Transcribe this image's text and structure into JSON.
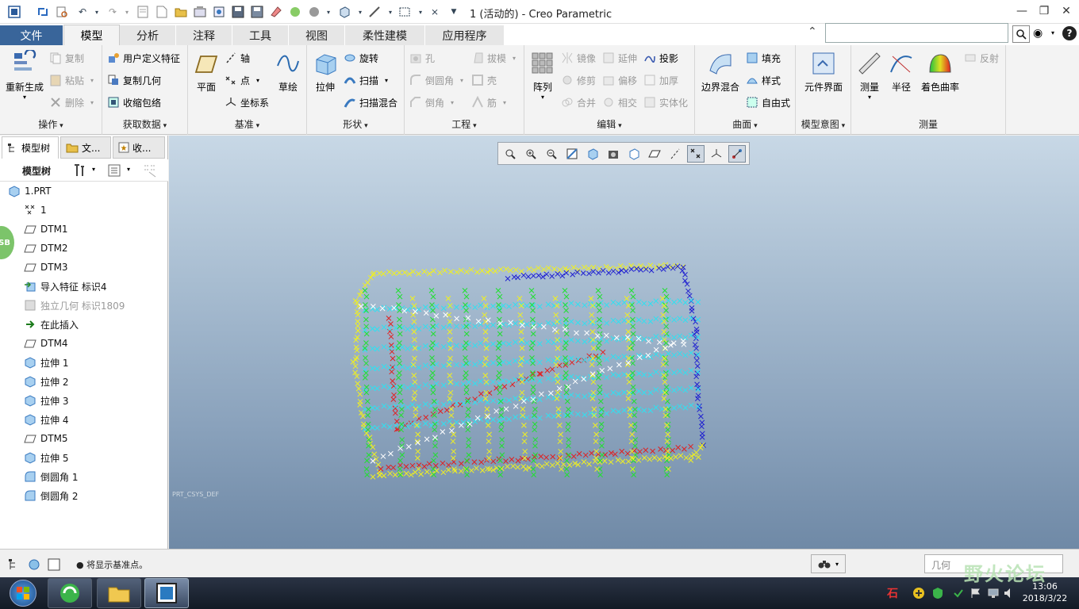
{
  "window": {
    "title": "1 (活动的) - Creo Parametric"
  },
  "tabs": [
    {
      "label": "文件"
    },
    {
      "label": "模型"
    },
    {
      "label": "分析"
    },
    {
      "label": "注释"
    },
    {
      "label": "工具"
    },
    {
      "label": "视图"
    },
    {
      "label": "柔性建模"
    },
    {
      "label": "应用程序"
    }
  ],
  "ribbon": {
    "ops": {
      "regen": "重新生成",
      "copy": "复制",
      "paste": "粘贴",
      "delete": "删除",
      "name": "操作"
    },
    "get": {
      "udf": "用户定义特征",
      "copygeom": "复制几何",
      "shrink": "收缩包络",
      "name": "获取数据"
    },
    "datum": {
      "plane": "平面",
      "axis": "轴",
      "point": "点",
      "csys": "坐标系",
      "sketch": "草绘",
      "name": "基准"
    },
    "shape": {
      "extrude": "拉伸",
      "revolve": "旋转",
      "sweep": "扫描",
      "sweepblend": "扫描混合",
      "name": "形状"
    },
    "eng": {
      "hole": "孔",
      "round": "倒圆角",
      "chamfer": "倒角",
      "draft": "拔模",
      "shell": "壳",
      "rib": "筋",
      "name": "工程"
    },
    "edit": {
      "pattern": "阵列",
      "mirror": "镜像",
      "trim": "修剪",
      "merge": "合并",
      "extend": "延伸",
      "offset": "偏移",
      "intersect": "相交",
      "project": "投影",
      "thicken": "加厚",
      "solidify": "实体化",
      "name": "编辑"
    },
    "surface": {
      "boundary": "边界混合",
      "fill": "填充",
      "style": "样式",
      "freestyle": "自由式",
      "name": "曲面"
    },
    "intent": {
      "compif": "元件界面",
      "name": "模型意图"
    },
    "measure": {
      "measure": "测量",
      "radius": "半径",
      "shade": "着色曲率",
      "reflect": "反射",
      "name": "测量"
    }
  },
  "leftpanel": {
    "tabs": [
      {
        "label": "模型树"
      },
      {
        "label": "文..."
      },
      {
        "label": "收..."
      }
    ],
    "header": "模型树"
  },
  "tree": [
    {
      "label": "1.PRT",
      "icon": "part-icon"
    },
    {
      "label": "1",
      "icon": "point-set-icon"
    },
    {
      "label": "DTM1",
      "icon": "datum-plane-icon"
    },
    {
      "label": "DTM2",
      "icon": "datum-plane-icon"
    },
    {
      "label": "DTM3",
      "icon": "datum-plane-icon"
    },
    {
      "label": "导入特征 标识4",
      "icon": "import-icon"
    },
    {
      "label": "独立几何 标识1809",
      "icon": "geometry-icon",
      "muted": true
    },
    {
      "label": "在此插入",
      "icon": "insert-arrow-icon"
    },
    {
      "label": "DTM4",
      "icon": "datum-plane-icon"
    },
    {
      "label": "拉伸 1",
      "icon": "extrude-icon"
    },
    {
      "label": "拉伸 2",
      "icon": "extrude-icon"
    },
    {
      "label": "拉伸 3",
      "icon": "extrude-icon"
    },
    {
      "label": "拉伸 4",
      "icon": "extrude-icon"
    },
    {
      "label": "DTM5",
      "icon": "datum-plane-icon"
    },
    {
      "label": "拉伸 5",
      "icon": "extrude-icon"
    },
    {
      "label": "倒圆角 1",
      "icon": "round-icon"
    },
    {
      "label": "倒圆角 2",
      "icon": "round-icon"
    }
  ],
  "viewport": {
    "csys_label": "PRT_CSYS_DEF"
  },
  "status": {
    "message": "将显示基准点。",
    "filter": "几何"
  },
  "taskbar": {
    "time": "13:06",
    "date": "2018/3/22"
  },
  "watermark": "野火论坛"
}
